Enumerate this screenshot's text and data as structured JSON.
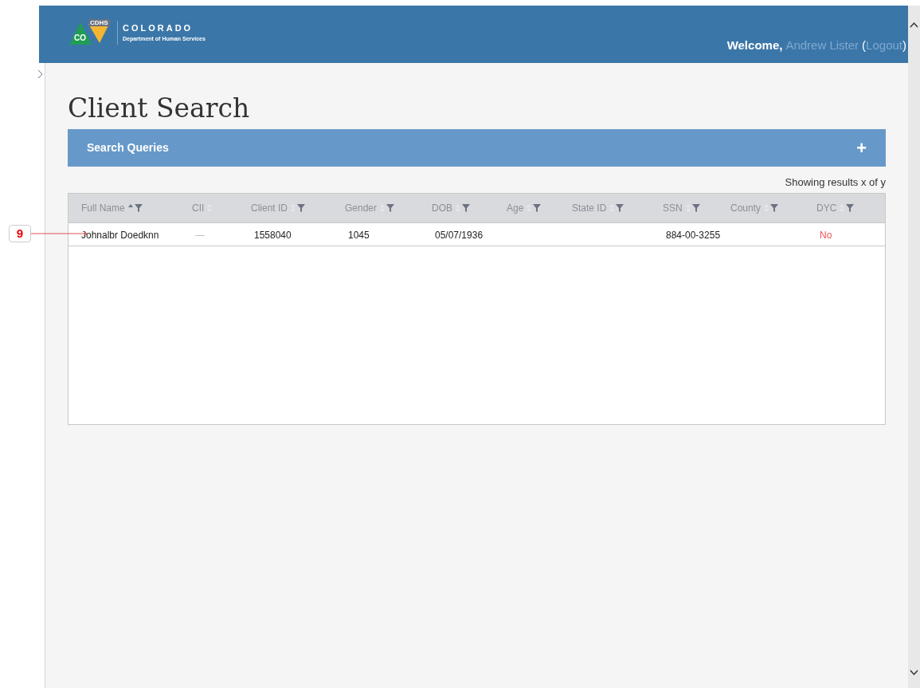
{
  "header": {
    "logo_badge": "CO",
    "logo_tag": "CDHS",
    "org_name": "COLORADO",
    "org_subtitle": "Department of Human Services",
    "welcome": "Welcome,",
    "user_name": "Andrew Lister",
    "logout_open": "(",
    "logout": "Logout",
    "logout_close": ")"
  },
  "page_title": "Client Search",
  "search_panel": {
    "title": "Search Queries",
    "expand": "+"
  },
  "results_summary": "Showing results x of y",
  "table": {
    "columns": [
      {
        "label": "Full Name",
        "sorted": true,
        "filter": true
      },
      {
        "label": "CII",
        "sorted": false,
        "filter": false
      },
      {
        "label": "Client ID",
        "sorted": false,
        "filter": true
      },
      {
        "label": "Gender",
        "sorted": false,
        "filter": true
      },
      {
        "label": "DOB",
        "sorted": false,
        "filter": true
      },
      {
        "label": "Age",
        "sorted": false,
        "filter": true
      },
      {
        "label": "State ID",
        "sorted": false,
        "filter": true
      },
      {
        "label": "SSN",
        "sorted": false,
        "filter": true
      },
      {
        "label": "County",
        "sorted": false,
        "filter": true
      },
      {
        "label": "DYC",
        "sorted": false,
        "filter": true
      }
    ],
    "rows": [
      {
        "cells": [
          "Johnalbr Doedknn",
          "—",
          "1558040",
          "1045",
          "05/07/1936",
          null,
          null,
          "884-00-3255",
          null,
          {
            "text": "No",
            "alert": true
          }
        ]
      }
    ]
  },
  "callout": {
    "label": "9"
  }
}
